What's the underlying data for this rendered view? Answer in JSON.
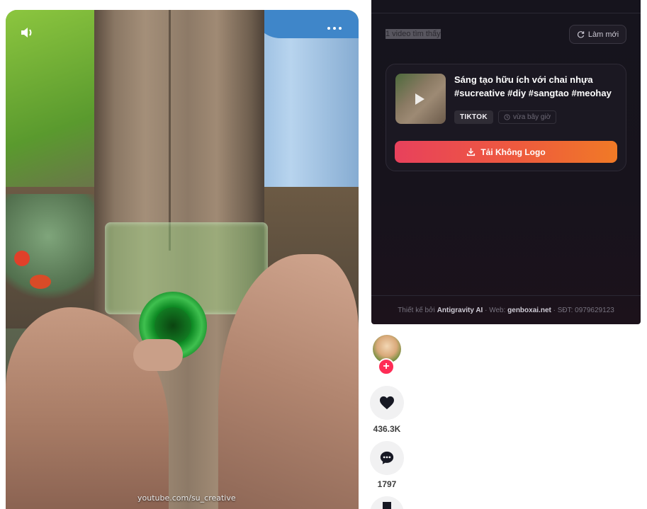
{
  "video": {
    "watermark": "youtube.com/su_creative",
    "sound_icon": "speaker-icon",
    "more_icon": "more-dots-icon"
  },
  "panel": {
    "found_text": "1 video tìm thấy",
    "refresh_label": "Làm mới",
    "card": {
      "title": "Sáng tạo hữu ích với chai nhựa #sucreative #diy #sangtao #meohay",
      "platform_badge": "TIKTOK",
      "time_label": "vừa bây giờ",
      "download_label": "Tải Không Logo"
    },
    "footer": {
      "prefix": "Thiết kế bởi",
      "designer": "Antigravity AI",
      "web_prefix": " · Web: ",
      "web": "genboxai.net",
      "phone": " · SĐT: 0979629123"
    },
    "colors": {
      "download_gradient_start": "#e8415c",
      "download_gradient_end": "#f07a26",
      "panel_bg": "#16141d"
    }
  },
  "actions": {
    "follow_label": "+",
    "likes": "436.3K",
    "comments": "1797",
    "follow_color": "#fe2c55"
  }
}
